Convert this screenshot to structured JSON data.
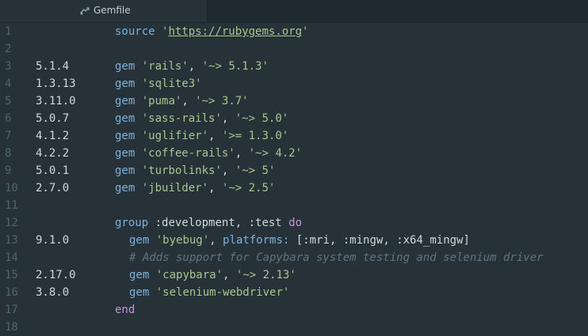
{
  "tab": {
    "title": "Gemfile",
    "icon": "ruby-file-icon"
  },
  "colors": {
    "background": "#263238",
    "line_number": "#4d6570",
    "keyword": "#7ab2e0",
    "string": "#a8c68f",
    "text": "#cfd8dc",
    "comment": "#5d7681",
    "do_keyword": "#c592d8"
  },
  "lines": [
    {
      "n": "1",
      "version": "",
      "code": {
        "kw": "source",
        "s1": "'",
        "url": "https://rubygems.org",
        "s2": "'"
      }
    },
    {
      "n": "2"
    },
    {
      "n": "3",
      "version": "5.1.4",
      "gem": "'rails'",
      "req": "'~> 5.1.3'"
    },
    {
      "n": "4",
      "version": "1.3.13",
      "gem": "'sqlite3'"
    },
    {
      "n": "5",
      "version": "3.11.0",
      "gem": "'puma'",
      "req": "'~> 3.7'"
    },
    {
      "n": "6",
      "version": "5.0.7",
      "gem": "'sass-rails'",
      "req": "'~> 5.0'"
    },
    {
      "n": "7",
      "version": "4.1.2",
      "gem": "'uglifier'",
      "req": "'>= 1.3.0'"
    },
    {
      "n": "8",
      "version": "4.2.2",
      "gem": "'coffee-rails'",
      "req": "'~> 4.2'"
    },
    {
      "n": "9",
      "version": "5.0.1",
      "gem": "'turbolinks'",
      "req": "'~> 5'"
    },
    {
      "n": "10",
      "version": "2.7.0",
      "gem": "'jbuilder'",
      "req": "'~> 2.5'"
    },
    {
      "n": "11"
    },
    {
      "n": "12",
      "group": {
        "kw": "group",
        "rest": " :development, :test ",
        "do": "do"
      }
    },
    {
      "n": "13",
      "version": "9.1.0",
      "gem": "'byebug'",
      "extra": {
        "key": "platforms:",
        "val": " [:mri, :mingw, :x64_mingw]"
      }
    },
    {
      "n": "14",
      "comment": "# Adds support for Capybara system testing and selenium driver"
    },
    {
      "n": "15",
      "version": "2.17.0",
      "gem": "'capybara'",
      "req": "'~> 2.13'"
    },
    {
      "n": "16",
      "version": "3.8.0",
      "gem": "'selenium-webdriver'"
    },
    {
      "n": "17",
      "end": "end"
    },
    {
      "n": "18"
    }
  ],
  "kw_gem": "gem"
}
